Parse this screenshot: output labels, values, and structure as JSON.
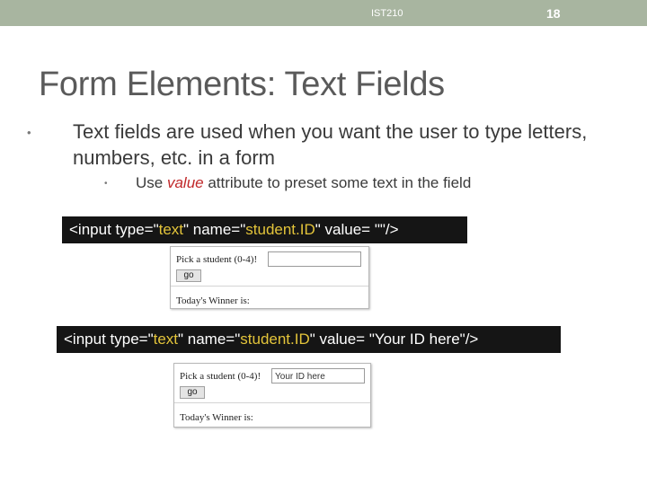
{
  "header": {
    "course": "IST210",
    "page_number": "18",
    "bar_color": "#a8b5a0"
  },
  "slide": {
    "title": "Form Elements: Text Fields",
    "bullet_main": "Text fields are used when you want the user to type letters, numbers, etc. in a form",
    "sub_bullet": {
      "prefix": "Use ",
      "keyword": "value",
      "suffix": " attribute to preset some text in the field"
    }
  },
  "code_examples": [
    {
      "p1": "<input type=\"",
      "v1": "text",
      "p2": "\" name=\"",
      "v2": "student.ID",
      "p3": "\"  value= \"\"/>"
    },
    {
      "p1": "<input type=\"",
      "v1": "text",
      "p2": "\" name=\"",
      "v2": "student.ID",
      "p3": "\"  value= \"Your ID here\"/>"
    }
  ],
  "forms": [
    {
      "label": "Pick a student (0-4)!",
      "input_value": "",
      "button": "go",
      "winner_label": "Today's Winner is:"
    },
    {
      "label": "Pick a student (0-4)!",
      "input_value": "Your ID here",
      "button": "go",
      "winner_label": "Today's Winner is:"
    }
  ],
  "colors": {
    "keyword_red": "#c0282a",
    "code_highlight": "#e3c43a",
    "code_bg": "#151515"
  }
}
